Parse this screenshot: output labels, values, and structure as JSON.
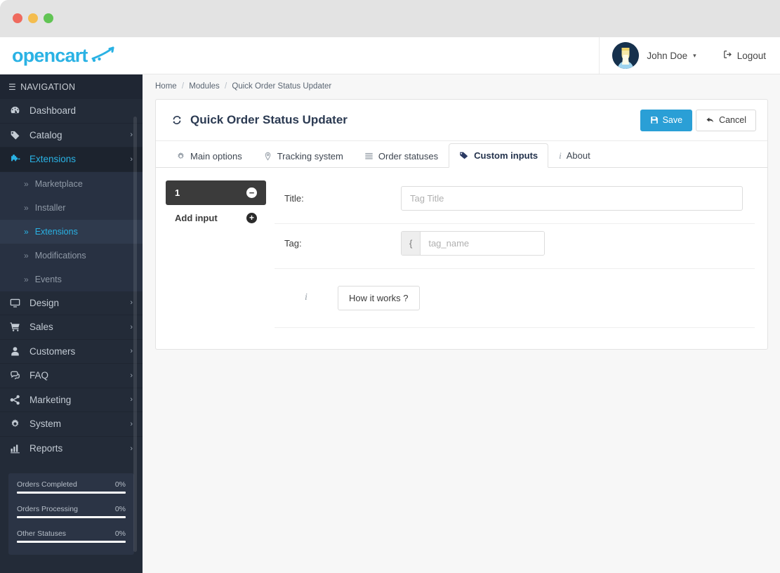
{
  "window": {
    "traffic_lights": [
      {
        "name": "close",
        "color": "#ef6a5e"
      },
      {
        "name": "minimize",
        "color": "#f4bd4f"
      },
      {
        "name": "maximize",
        "color": "#61c454"
      }
    ]
  },
  "brand": {
    "logo_text": "opencart",
    "logo_color": "#2ab2e4"
  },
  "sidebar": {
    "nav_header": "NAVIGATION",
    "items": [
      {
        "label": "Dashboard",
        "icon": "dashboard-icon",
        "caret": "",
        "active": false
      },
      {
        "label": "Catalog",
        "icon": "tag-icon",
        "caret": "›",
        "active": false
      },
      {
        "label": "Extensions",
        "icon": "puzzle-icon",
        "caret": "›",
        "active": true
      }
    ],
    "subitems": [
      {
        "label": "Marketplace",
        "chev": "»",
        "active": false
      },
      {
        "label": "Installer",
        "chev": "»",
        "active": false
      },
      {
        "label": "Extensions",
        "chev": "»",
        "active": true
      },
      {
        "label": "Modifications",
        "chev": "»",
        "active": false
      },
      {
        "label": "Events",
        "chev": "»",
        "active": false
      }
    ],
    "items_bottom": [
      {
        "label": "Design",
        "icon": "monitor-icon",
        "caret": "›"
      },
      {
        "label": "Sales",
        "icon": "cart-icon",
        "caret": "›"
      },
      {
        "label": "Customers",
        "icon": "user-icon",
        "caret": "›"
      },
      {
        "label": "FAQ",
        "icon": "comments-icon",
        "caret": "›"
      },
      {
        "label": "Marketing",
        "icon": "share-icon",
        "caret": "›"
      },
      {
        "label": "System",
        "icon": "gear-icon",
        "caret": "›"
      },
      {
        "label": "Reports",
        "icon": "bar-chart-icon",
        "caret": "›"
      }
    ],
    "stats": [
      {
        "label": "Orders Completed",
        "value": "0%",
        "percent": 100
      },
      {
        "label": "Orders Processing",
        "value": "0%",
        "percent": 100
      },
      {
        "label": "Other Statuses",
        "value": "0%",
        "percent": 100
      }
    ]
  },
  "topbar": {
    "user_name": "John Doe",
    "user_caret": "▾",
    "logout_label": "Logout"
  },
  "breadcrumb": {
    "home": "Home",
    "modules": "Modules",
    "current": "Quick Order Status Updater",
    "sep": "/"
  },
  "panel": {
    "title": "Quick Order Status Updater",
    "save_label": "Save",
    "cancel_label": "Cancel"
  },
  "tabs": [
    {
      "label": "Main options",
      "icon": "gear-icon",
      "active": false
    },
    {
      "label": "Tracking system",
      "icon": "location-pin-icon",
      "active": false
    },
    {
      "label": "Order statuses",
      "icon": "list-icon",
      "active": false
    },
    {
      "label": "Custom inputs",
      "icon": "tag-icon",
      "active": true
    },
    {
      "label": "About",
      "icon": "info-icon",
      "active": false
    }
  ],
  "custom_inputs": {
    "list": [
      {
        "label": "1",
        "remove_glyph": "−"
      }
    ],
    "add_label": "Add input",
    "add_glyph": "+",
    "fields": {
      "title_label": "Title:",
      "title_value": "",
      "title_placeholder": "Tag Title",
      "tag_label": "Tag:",
      "tag_value": "",
      "tag_placeholder": "tag_name",
      "tag_prefix": "{",
      "tag_suffix": "}"
    },
    "help": {
      "info_glyph": "i",
      "button_label": "How it works ?"
    }
  },
  "colors": {
    "accent": "#2ab2e4",
    "sidebar_bg": "#232b38",
    "save_button": "#2a9fd6",
    "chip_bg": "#3b3b3b"
  }
}
